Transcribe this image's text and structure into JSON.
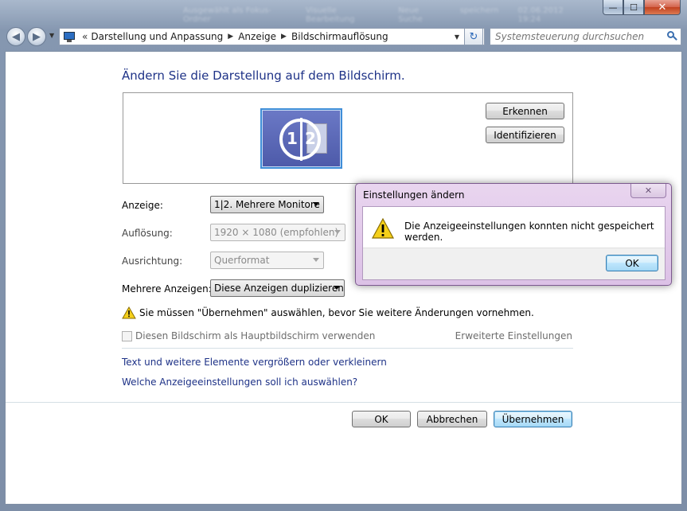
{
  "titlebar": {
    "blurred_tasks": [
      "Ausgewählt als Fokus-Ordner",
      "Visuelle Bearbeitung",
      "Neue Suche",
      "speichern",
      "02.06.2012 19:24"
    ],
    "min_glyph": "—",
    "max_glyph": "☐",
    "close_glyph": "✕"
  },
  "nav": {
    "back_glyph": "◀",
    "forward_glyph": "▶",
    "history_glyph": "▼",
    "address_chevron": "«",
    "breadcrumbs": [
      "Darstellung und Anpassung",
      "Anzeige",
      "Bildschirmauflösung"
    ],
    "crumb_separator": "▶",
    "address_dropdown_glyph": "▼",
    "refresh_glyph": "↻",
    "search_placeholder": "Systemsteuerung durchsuchen"
  },
  "main": {
    "title": "Ändern Sie die Darstellung auf dem Bildschirm.",
    "monitor": {
      "label_1": "1",
      "label_2": "2"
    },
    "detect_button": "Erkennen",
    "identify_button": "Identifizieren",
    "display_label": "Anzeige:",
    "display_value": "1|2. Mehrere Monitore",
    "resolution_label": "Auflösung:",
    "resolution_value": "1920 × 1080 (empfohlen)",
    "orientation_label": "Ausrichtung:",
    "orientation_value": "Querformat",
    "multi_label": "Mehrere Anzeigen:",
    "multi_value": "Diese Anzeigen duplizieren",
    "warning_text": "Sie müssen \"Übernehmen\" auswählen, bevor Sie weitere Änderungen vornehmen.",
    "primary_checkbox_label": "Diesen Bildschirm als Hauptbildschirm verwenden",
    "primary_checkbox_checked": false,
    "advanced_link": "Erweiterte Einstellungen",
    "link_resize": "Text und weitere Elemente vergrößern oder verkleinern",
    "link_which": "Welche Anzeigeeinstellungen soll ich auswählen?",
    "ok_button": "OK",
    "cancel_button": "Abbrechen",
    "apply_button": "Übernehmen"
  },
  "dialog": {
    "title": "Einstellungen ändern",
    "close_glyph": "✕",
    "message": "Die Anzeigeeinstellungen konnten nicht gespeichert werden.",
    "ok_button": "OK"
  },
  "colors": {
    "link_blue": "#1e3287",
    "dialog_frame": "#dcc1e6",
    "warning_yellow": "#f5d01a"
  }
}
